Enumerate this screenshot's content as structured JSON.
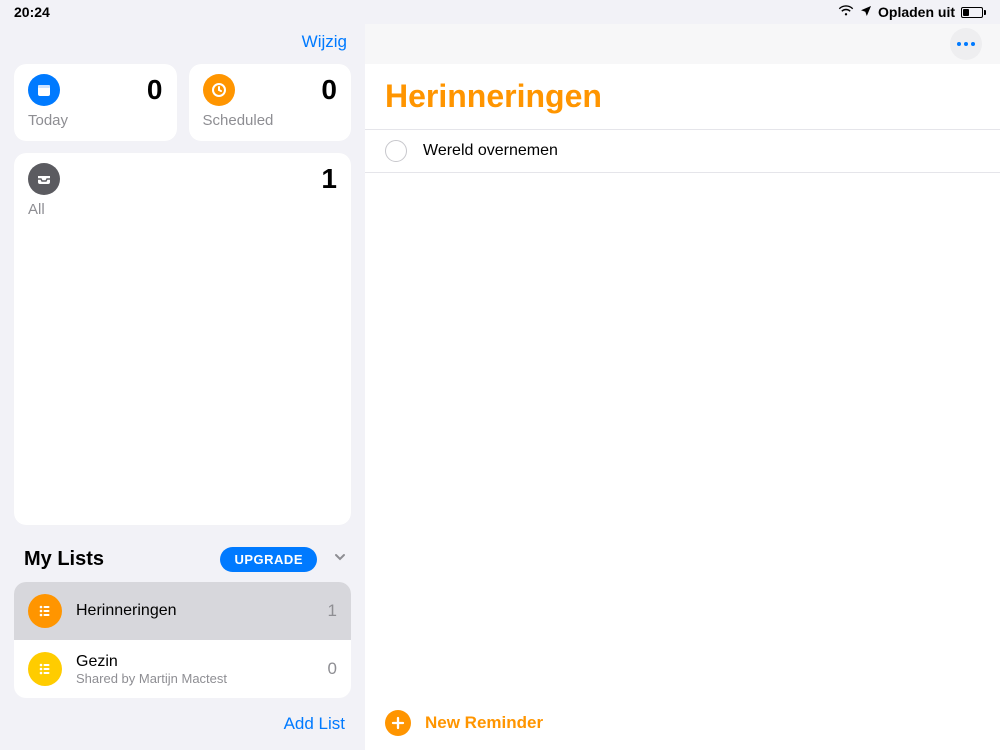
{
  "status": {
    "time": "20:24",
    "charging_label": "Opladen uit"
  },
  "sidebar": {
    "edit_label": "Wijzig",
    "cards": {
      "today": {
        "label": "Today",
        "count": "0"
      },
      "scheduled": {
        "label": "Scheduled",
        "count": "0"
      },
      "all": {
        "label": "All",
        "count": "1"
      }
    },
    "mylists_title": "My Lists",
    "upgrade_label": "UPGRADE",
    "lists": [
      {
        "title": "Herinneringen",
        "subtitle": "",
        "count": "1",
        "color": "#ff9500",
        "selected": true
      },
      {
        "title": "Gezin",
        "subtitle": "Shared by Martijn Mactest",
        "count": "0",
        "color": "#ffcc00",
        "selected": false
      }
    ],
    "add_list_label": "Add List"
  },
  "main": {
    "heading": "Herinneringen",
    "reminders": [
      {
        "text": "Wereld overnemen"
      }
    ],
    "new_reminder_label": "New Reminder"
  }
}
